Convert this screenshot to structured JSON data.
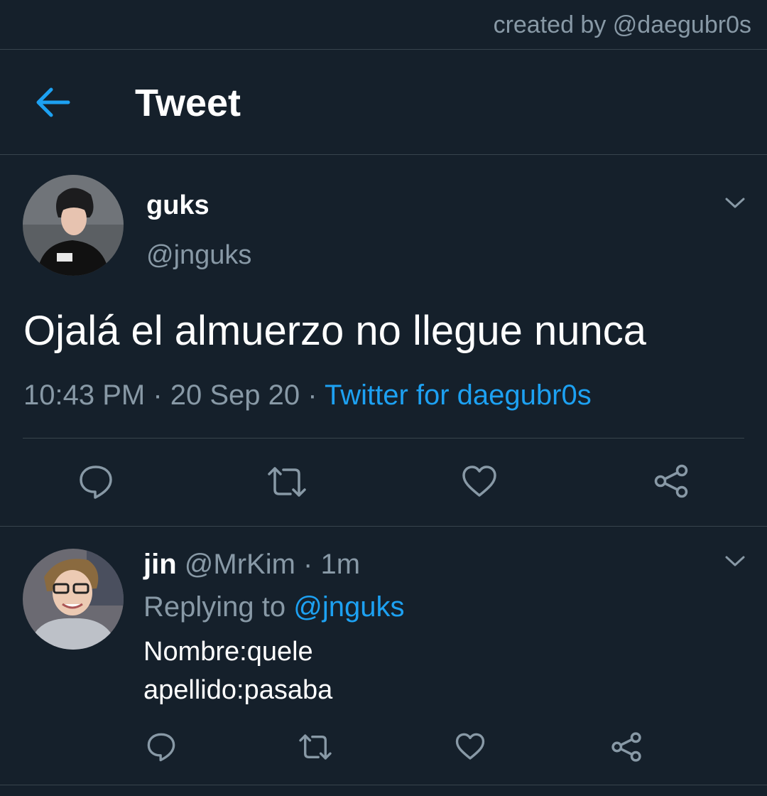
{
  "credit": "created by @daegubr0s",
  "header": {
    "title": "Tweet"
  },
  "tweet": {
    "display_name": "guks",
    "handle": "@jnguks",
    "text": "Ojalá el almuerzo no llegue nunca",
    "time": "10:43 PM",
    "separator": " · ",
    "date": "20 Sep 20",
    "source": "Twitter for daegubr0s"
  },
  "reply": {
    "display_name": "jin",
    "handle": "@MrKim",
    "time": "1m",
    "separator": " · ",
    "replying_label": "Replying to",
    "replying_to": "@jnguks",
    "lines": [
      "Nombre:quele",
      "apellido:pasaba"
    ]
  },
  "icons": {
    "back": "arrow-left-icon",
    "more": "chevron-down-icon",
    "reply": "speech-bubble-icon",
    "retweet": "retweet-icon",
    "like": "heart-icon",
    "share": "share-icon"
  },
  "colors": {
    "background": "#15202b",
    "accent": "#1da1f2",
    "secondary_text": "#8899a6",
    "divider": "#38444d"
  }
}
